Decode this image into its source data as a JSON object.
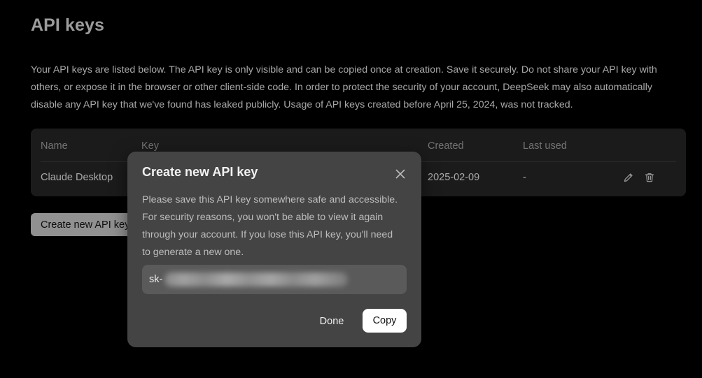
{
  "page": {
    "title": "API keys",
    "description": "Your API keys are listed below. The API key is only visible and can be copied once at creation. Save it securely. Do not share your API key with others, or expose it in the browser or other client-side code. In order to protect the security of your account, DeepSeek may also automatically disable any API key that we've found has leaked publicly. Usage of API keys created before April 25, 2024, was not tracked."
  },
  "table": {
    "columns": [
      "Name",
      "Key",
      "Created",
      "Last used"
    ],
    "rows": [
      {
        "name": "Claude Desktop",
        "key": "",
        "created": "2025-02-09",
        "last_used": "-",
        "edit_icon": "pencil-icon",
        "delete_icon": "trash-icon"
      }
    ]
  },
  "create_button": {
    "label": "Create new API key"
  },
  "modal": {
    "title": "Create new API key",
    "close_icon": "close-icon",
    "message": "Please save this API key somewhere safe and accessible. For security reasons, you won't be able to view it again through your account. If you lose this API key, you'll need to generate a new one.",
    "key_prefix": "sk-",
    "done_label": "Done",
    "copy_label": "Copy"
  },
  "colors": {
    "background": "#000000",
    "table_bg": "#262626",
    "modal_bg": "#444444",
    "key_field_bg": "#5a5a5a",
    "button_bg": "#c9c9c9",
    "copy_button_bg": "#ffffff"
  }
}
